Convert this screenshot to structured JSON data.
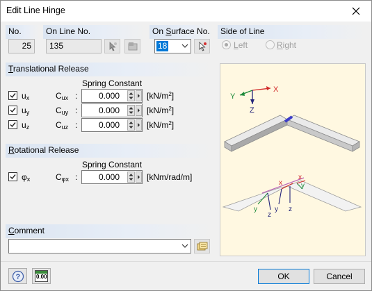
{
  "window": {
    "title": "Edit Line Hinge"
  },
  "no": {
    "label": "No.",
    "value": "25"
  },
  "on_line": {
    "label": "On Line No.",
    "value": "135"
  },
  "on_surface": {
    "label": "On Surface No.",
    "value": "18"
  },
  "side_of_line": {
    "label": "Side of Line",
    "left_label": "Left",
    "right_label": "Right",
    "selected": "Left"
  },
  "translational": {
    "label": "Translational Release",
    "spring_header": "Spring Constant",
    "rows": [
      {
        "checked": true,
        "dof": "u",
        "dof_sub": "x",
        "const": "C",
        "const_sub": "ux",
        "colon": ":",
        "value": "0.000",
        "unit_pre": "[kN/m",
        "unit_sup": "2",
        "unit_post": "]"
      },
      {
        "checked": true,
        "dof": "u",
        "dof_sub": "y",
        "const": "C",
        "const_sub": "uy",
        "colon": ":",
        "value": "0.000",
        "unit_pre": "[kN/m",
        "unit_sup": "2",
        "unit_post": "]"
      },
      {
        "checked": true,
        "dof": "u",
        "dof_sub": "z",
        "const": "C",
        "const_sub": "uz",
        "colon": ":",
        "value": "0.000",
        "unit_pre": "[kN/m",
        "unit_sup": "2",
        "unit_post": "]"
      }
    ]
  },
  "rotational": {
    "label": "Rotational Release",
    "spring_header": "Spring Constant",
    "rows": [
      {
        "checked": true,
        "dof": "φ",
        "dof_sub": "x",
        "const": "C",
        "const_sub": "φx",
        "colon": ":",
        "value": "0.000",
        "unit": "[kNm/rad/m]"
      }
    ]
  },
  "comment": {
    "label": "Comment",
    "value": ""
  },
  "preview": {
    "axis_x": "X",
    "axis_y": "Y",
    "axis_z": "Z",
    "local_x": "x",
    "local_y": "y",
    "local_z": "z"
  },
  "bottom": {
    "units_icon_text": "0.00",
    "ok_label": "OK",
    "cancel_label": "Cancel"
  }
}
